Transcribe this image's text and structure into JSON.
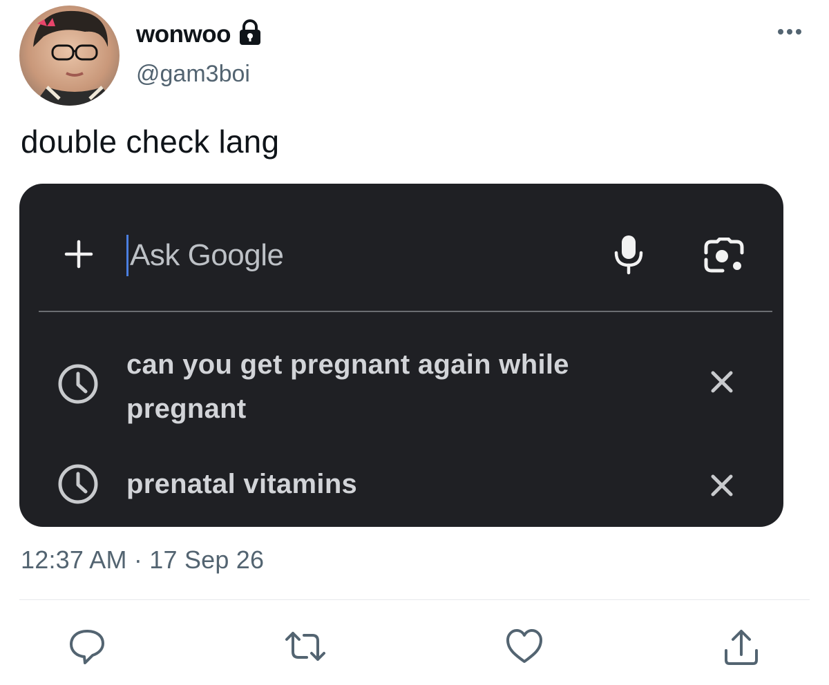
{
  "user": {
    "display_name": "wonwoo",
    "handle": "@gam3boi",
    "protected_icon": "lock-icon"
  },
  "tweet": {
    "text": "double check lang",
    "timestamp": "12:37 AM · 17 Sep 26"
  },
  "search_card": {
    "placeholder": "Ask Google",
    "icons": [
      "plus-icon",
      "microphone-icon",
      "camera-lens-icon"
    ],
    "suggestions": [
      {
        "text": "can you get pregnant again while pregnant",
        "icon": "history-clock-icon"
      },
      {
        "text": "prenatal vitamins",
        "icon": "history-clock-icon"
      }
    ]
  },
  "actions": [
    "reply-icon",
    "retweet-icon",
    "like-icon",
    "share-icon"
  ],
  "colors": {
    "card_bg": "#1f2024",
    "secondary_text": "#536471",
    "caret": "#4b7fe0"
  }
}
